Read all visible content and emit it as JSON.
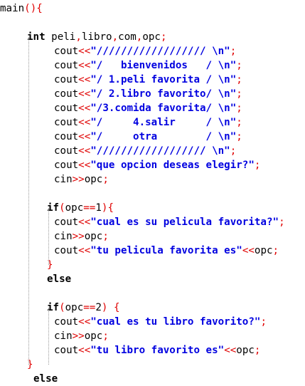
{
  "lines": [
    {
      "indent": 0,
      "parts": [
        {
          "t": "id",
          "v": "main"
        },
        {
          "t": "op",
          "v": "(){"
        }
      ]
    },
    {
      "indent": 0,
      "parts": []
    },
    {
      "indent": 38,
      "parts": [
        {
          "t": "kw",
          "v": "int"
        },
        {
          "t": "id",
          "v": " peli"
        },
        {
          "t": "op",
          "v": ","
        },
        {
          "t": "id",
          "v": "libro"
        },
        {
          "t": "op",
          "v": ","
        },
        {
          "t": "id",
          "v": "com"
        },
        {
          "t": "op",
          "v": ","
        },
        {
          "t": "id",
          "v": "opc"
        },
        {
          "t": "op",
          "v": ";"
        }
      ]
    },
    {
      "indent": 76,
      "parts": [
        {
          "t": "id",
          "v": "cout"
        },
        {
          "t": "op",
          "v": "<<"
        },
        {
          "t": "str",
          "v": "\"////////////////// \\n\""
        },
        {
          "t": "op",
          "v": ";"
        }
      ]
    },
    {
      "indent": 76,
      "parts": [
        {
          "t": "id",
          "v": "cout"
        },
        {
          "t": "op",
          "v": "<<"
        },
        {
          "t": "str",
          "v": "\"/   bienvenidos   / \\n\""
        },
        {
          "t": "op",
          "v": ";"
        }
      ]
    },
    {
      "indent": 76,
      "parts": [
        {
          "t": "id",
          "v": "cout"
        },
        {
          "t": "op",
          "v": "<<"
        },
        {
          "t": "str",
          "v": "\"/ 1.peli favorita / \\n\""
        },
        {
          "t": "op",
          "v": ";"
        }
      ]
    },
    {
      "indent": 76,
      "parts": [
        {
          "t": "id",
          "v": "cout"
        },
        {
          "t": "op",
          "v": "<<"
        },
        {
          "t": "str",
          "v": "\"/ 2.libro favorito/ \\n\""
        },
        {
          "t": "op",
          "v": ";"
        }
      ]
    },
    {
      "indent": 76,
      "parts": [
        {
          "t": "id",
          "v": "cout"
        },
        {
          "t": "op",
          "v": "<<"
        },
        {
          "t": "str",
          "v": "\"/3.comida favorita/ \\n\""
        },
        {
          "t": "op",
          "v": ";"
        }
      ]
    },
    {
      "indent": 76,
      "parts": [
        {
          "t": "id",
          "v": "cout"
        },
        {
          "t": "op",
          "v": "<<"
        },
        {
          "t": "str",
          "v": "\"/     4.salir     / \\n\""
        },
        {
          "t": "op",
          "v": ";"
        }
      ]
    },
    {
      "indent": 76,
      "parts": [
        {
          "t": "id",
          "v": "cout"
        },
        {
          "t": "op",
          "v": "<<"
        },
        {
          "t": "str",
          "v": "\"/     otra        / \\n\""
        },
        {
          "t": "op",
          "v": ";"
        }
      ]
    },
    {
      "indent": 76,
      "parts": [
        {
          "t": "id",
          "v": "cout"
        },
        {
          "t": "op",
          "v": "<<"
        },
        {
          "t": "str",
          "v": "\"////////////////// \\n\""
        },
        {
          "t": "op",
          "v": ";"
        }
      ]
    },
    {
      "indent": 76,
      "parts": [
        {
          "t": "id",
          "v": "cout"
        },
        {
          "t": "op",
          "v": "<<"
        },
        {
          "t": "str",
          "v": "\"que opcion deseas elegir?\""
        },
        {
          "t": "op",
          "v": ";"
        }
      ]
    },
    {
      "indent": 76,
      "parts": [
        {
          "t": "id",
          "v": "cin"
        },
        {
          "t": "op",
          "v": ">>"
        },
        {
          "t": "id",
          "v": "opc"
        },
        {
          "t": "op",
          "v": ";"
        }
      ]
    },
    {
      "indent": 0,
      "parts": []
    },
    {
      "indent": 66,
      "parts": [
        {
          "t": "kw",
          "v": "if"
        },
        {
          "t": "op",
          "v": "("
        },
        {
          "t": "id",
          "v": "opc"
        },
        {
          "t": "op",
          "v": "=="
        },
        {
          "t": "id",
          "v": "1"
        },
        {
          "t": "op",
          "v": "){"
        }
      ]
    },
    {
      "indent": 76,
      "parts": [
        {
          "t": "id",
          "v": "cout"
        },
        {
          "t": "op",
          "v": "<<"
        },
        {
          "t": "str",
          "v": "\"cual es su pelicula favorita?\""
        },
        {
          "t": "op",
          "v": ";"
        }
      ]
    },
    {
      "indent": 76,
      "parts": [
        {
          "t": "id",
          "v": "cin"
        },
        {
          "t": "op",
          "v": ">>"
        },
        {
          "t": "id",
          "v": "opc"
        },
        {
          "t": "op",
          "v": ";"
        }
      ]
    },
    {
      "indent": 76,
      "parts": [
        {
          "t": "id",
          "v": "cout"
        },
        {
          "t": "op",
          "v": "<<"
        },
        {
          "t": "str",
          "v": "\"tu pelicula favorita es\""
        },
        {
          "t": "op",
          "v": "<<"
        },
        {
          "t": "id",
          "v": "opc"
        },
        {
          "t": "op",
          "v": ";"
        }
      ]
    },
    {
      "indent": 66,
      "parts": [
        {
          "t": "op",
          "v": "}"
        }
      ]
    },
    {
      "indent": 66,
      "parts": [
        {
          "t": "kw",
          "v": "else"
        }
      ]
    },
    {
      "indent": 0,
      "parts": []
    },
    {
      "indent": 66,
      "parts": [
        {
          "t": "kw",
          "v": "if"
        },
        {
          "t": "op",
          "v": "("
        },
        {
          "t": "id",
          "v": "opc"
        },
        {
          "t": "op",
          "v": "=="
        },
        {
          "t": "id",
          "v": "2"
        },
        {
          "t": "op",
          "v": ") {"
        }
      ]
    },
    {
      "indent": 76,
      "parts": [
        {
          "t": "id",
          "v": "cout"
        },
        {
          "t": "op",
          "v": "<<"
        },
        {
          "t": "str",
          "v": "\"cual es tu libro favorito?\""
        },
        {
          "t": "op",
          "v": ";"
        }
      ]
    },
    {
      "indent": 76,
      "parts": [
        {
          "t": "id",
          "v": "cin"
        },
        {
          "t": "op",
          "v": ">>"
        },
        {
          "t": "id",
          "v": "opc"
        },
        {
          "t": "op",
          "v": ";"
        }
      ]
    },
    {
      "indent": 76,
      "parts": [
        {
          "t": "id",
          "v": "cout"
        },
        {
          "t": "op",
          "v": "<<"
        },
        {
          "t": "str",
          "v": "\"tu libro favorito es\""
        },
        {
          "t": "op",
          "v": "<<"
        },
        {
          "t": "id",
          "v": "opc"
        },
        {
          "t": "op",
          "v": ";"
        }
      ]
    },
    {
      "indent": 38,
      "parts": [
        {
          "t": "op",
          "v": "}"
        }
      ]
    },
    {
      "indent": 47,
      "parts": [
        {
          "t": "kw",
          "v": "else"
        }
      ]
    }
  ],
  "colors": {
    "keyword": "#000000",
    "string": "#0000e0",
    "operator": "#e00000",
    "identifier": "#000000",
    "guide": "#9a9a9a"
  }
}
